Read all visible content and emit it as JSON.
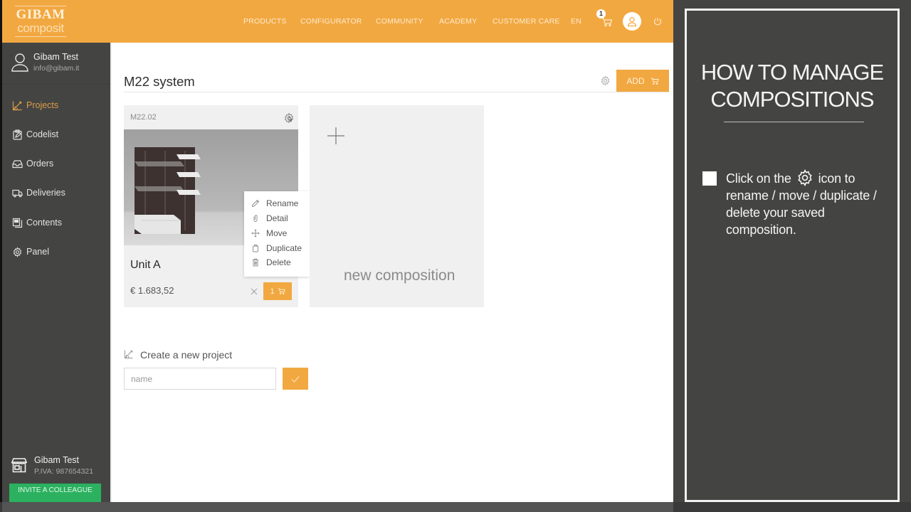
{
  "header": {
    "logo": {
      "line1": "GIBAM",
      "line2": "composit"
    },
    "nav": [
      "PRODUCTS",
      "CONFIGURATOR",
      "COMMUNITY",
      "ACADEMY",
      "CUSTOMER CARE",
      "EN"
    ],
    "cart_count": "1",
    "icons": {
      "cart": "cart-icon",
      "user": "user-icon",
      "power": "power-icon"
    }
  },
  "sidebar": {
    "user": {
      "name": "Gibam Test",
      "email": "info@gibam.it"
    },
    "items": [
      {
        "label": "Projects",
        "icon": "projects-icon",
        "active": true
      },
      {
        "label": "Codelist",
        "icon": "clipboard-icon",
        "active": false
      },
      {
        "label": "Orders",
        "icon": "inbox-icon",
        "active": false
      },
      {
        "label": "Deliveries",
        "icon": "truck-icon",
        "active": false
      },
      {
        "label": "Contents",
        "icon": "documents-icon",
        "active": false
      },
      {
        "label": "Panel",
        "icon": "gear-icon",
        "active": false
      }
    ],
    "company": {
      "name": "Gibam Test",
      "vat": "P.IVA: 987654321"
    },
    "invite_button": "INVITE A COLLEAGUE"
  },
  "main": {
    "title": "M22 system",
    "add_button": "ADD",
    "composition": {
      "code": "M22.02",
      "name": "Unit A",
      "price": "€ 1.683,52",
      "quantity": "1"
    },
    "context_menu": [
      {
        "label": "Rename",
        "icon": "pencil-icon"
      },
      {
        "label": "Detail",
        "icon": "paperclip-icon"
      },
      {
        "label": "Move",
        "icon": "move-icon"
      },
      {
        "label": "Duplicate",
        "icon": "duplicate-icon"
      },
      {
        "label": "Delete",
        "icon": "trash-icon"
      }
    ],
    "new_composition": "new composition",
    "new_project": {
      "label": "Create a new project",
      "placeholder": "name",
      "value": ""
    }
  },
  "tutorial": {
    "title_line1": "HOW TO MANAGE",
    "title_line2": "COMPOSITIONS",
    "text_before_icon": "Click on the",
    "text_after_icon": "icon to rename / move / duplicate / delete your saved composition."
  },
  "colors": {
    "brand_orange": "#f2a840",
    "sidebar_bg": "#444542",
    "active_item": "#dd9c4a",
    "invite_green": "#2bb15f"
  }
}
